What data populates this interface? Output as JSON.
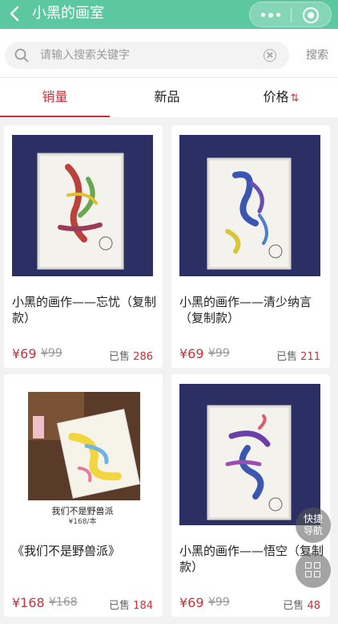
{
  "header": {
    "title": "小黑的画室",
    "back_icon": "chevron-left-icon",
    "more_icon": "more-dots-icon",
    "close_icon": "mini-program-close-icon",
    "color": "#5cc8a2"
  },
  "search": {
    "placeholder": "请输入搜索关键字",
    "value": "",
    "button_label": "搜索"
  },
  "tabs": [
    {
      "label": "销量",
      "active": true
    },
    {
      "label": "新品",
      "active": false
    },
    {
      "label": "价格",
      "active": false,
      "sort_icon": "⇅"
    }
  ],
  "products": [
    {
      "name": "小黑的画作——忘忧（复制款）",
      "price": "¥69",
      "original_price": "¥99",
      "sold_label": "已售",
      "sold_count": "286"
    },
    {
      "name": "小黑的画作——清少纳言（复制款）",
      "price": "¥69",
      "original_price": "¥99",
      "sold_label": "已售",
      "sold_count": "211"
    },
    {
      "name": "《我们不是野兽派》",
      "price": "¥168",
      "original_price": "¥168",
      "sold_label": "已售",
      "sold_count": "184",
      "image_caption": "我们不是野兽派",
      "image_price": "¥168/本"
    },
    {
      "name": "小黑的画作——悟空（复制款）",
      "price": "¥69",
      "original_price": "¥99",
      "sold_label": "已售",
      "sold_count": "48"
    }
  ],
  "floating": {
    "nav_label": "快捷导航",
    "grid_icon": "grid-icon"
  },
  "colors": {
    "accent": "#c8313b",
    "header": "#5cc8a2"
  }
}
